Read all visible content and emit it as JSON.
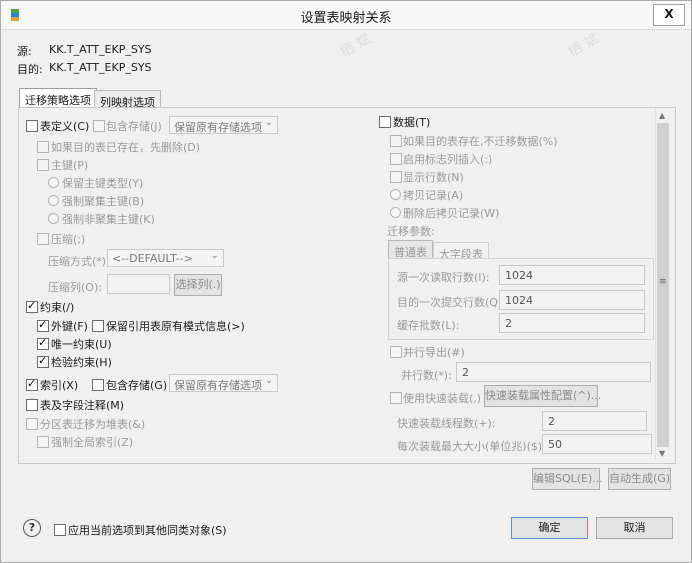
{
  "window": {
    "title": "设置表映射关系",
    "close": "X"
  },
  "source": {
    "label": "源:",
    "value": "KK.T_ATT_EKP_SYS"
  },
  "target": {
    "label": "目的:",
    "value": "KK.T_ATT_EKP_SYS"
  },
  "tabs": [
    "迁移策略选项",
    "列映射选项"
  ],
  "left": {
    "table_def": "表定义(C)",
    "include_storage": "包含存储(J)",
    "storage_select": "保留原有存储选项",
    "if_exists": "如果目的表已存在，先删除(D)",
    "primary_key": "主键(P)",
    "keep_pk_type": "保留主键类型(Y)",
    "force_clustered": "强制聚集主键(B)",
    "force_nonclustered": "强制非聚集主键(K)",
    "compress": "压缩(;)",
    "compress_method_label": "压缩方式(*):",
    "compress_method_value": "<--DEFAULT-->",
    "compress_cols_label": "压缩列(O):",
    "select_cols_button": "选择列(.)",
    "constraint": "约束(/)",
    "foreign_key": "外键(F)",
    "keep_ref_schema": "保留引用表原有模式信息(>)",
    "unique": "唯一约束(U)",
    "check": "检验约束(H)",
    "index": "索引(X)",
    "include_storage2": "包含存储(G)",
    "storage_select2": "保留原有存储选项",
    "table_comment": "表及字段注释(M)",
    "partition_heap": "分区表迁移为堆表(&)",
    "force_global_index": "强制全局索引(Z)"
  },
  "right": {
    "data": "数据(T)",
    "skip_if_exists": "如果目的表存在,不迁移数据(%)",
    "identity_insert": "启用标志列插入(:)",
    "show_rows": "显示行数(N)",
    "copy_records": "拷贝记录(A)",
    "delete_then_copy": "删除后拷贝记录(W)",
    "params_label": "迁移参数:",
    "subtabs": [
      "普通表",
      "大字段表"
    ],
    "read_rows_label": "源一次读取行数(I):",
    "read_rows_value": "1024",
    "commit_rows_label": "目的一次提交行数(Q):",
    "commit_rows_value": "1024",
    "batch_label": "缓存批数(L):",
    "batch_value": "2",
    "parallel_export": "并行导出(#)",
    "parallel_count_label": "并行数(*):",
    "parallel_count_value": "2",
    "fast_load": "使用快速装载(,)",
    "fast_load_config": "快速装载属性配置(^)...",
    "fast_threads_label": "快速装载线程数(+):",
    "fast_threads_value": "2",
    "max_size_label": "每次装载最大大小(单位兆)($):",
    "max_size_value": "50"
  },
  "buttons": {
    "edit_sql": "编辑SQL(E)...",
    "auto_generate": "自动生成(G)",
    "apply_same": "应用当前选项到其他同类对象(S)",
    "ok": "确定",
    "cancel": "取消"
  },
  "watermark": "栖斌"
}
